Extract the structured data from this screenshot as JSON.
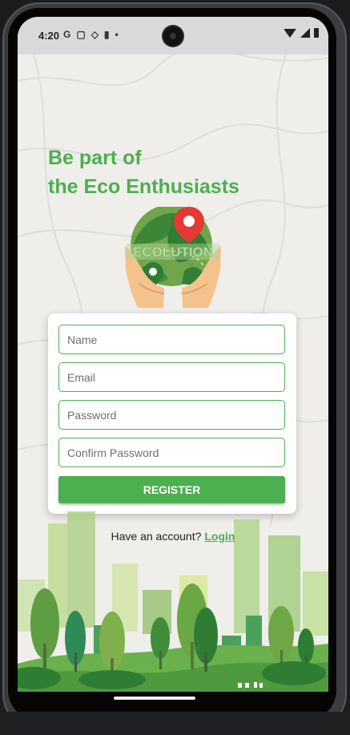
{
  "status_bar": {
    "time": "4:20",
    "left_icons": [
      "google-g-icon",
      "screen-record-icon",
      "vpn-shield-icon",
      "sim-card-icon",
      "dot-icon"
    ],
    "right_icons": [
      "wifi-icon",
      "signal-icon",
      "battery-icon"
    ],
    "left_glyphs": [
      "G",
      "▢",
      "◇",
      "▮",
      "•"
    ]
  },
  "app": {
    "headline_line1": "Be part of",
    "headline_line2": "the Eco Enthusiasts",
    "logo_text": "ECOLUTION"
  },
  "form": {
    "name_placeholder": "Name",
    "email_placeholder": "Email",
    "password_placeholder": "Password",
    "confirm_password_placeholder": "Confirm Password",
    "register_label": "REGISTER"
  },
  "footer": {
    "prompt": "Have an account?",
    "login_label": "Login"
  },
  "colors": {
    "accent": "#4caf50",
    "background": "#efeeea",
    "card": "#ffffff"
  }
}
